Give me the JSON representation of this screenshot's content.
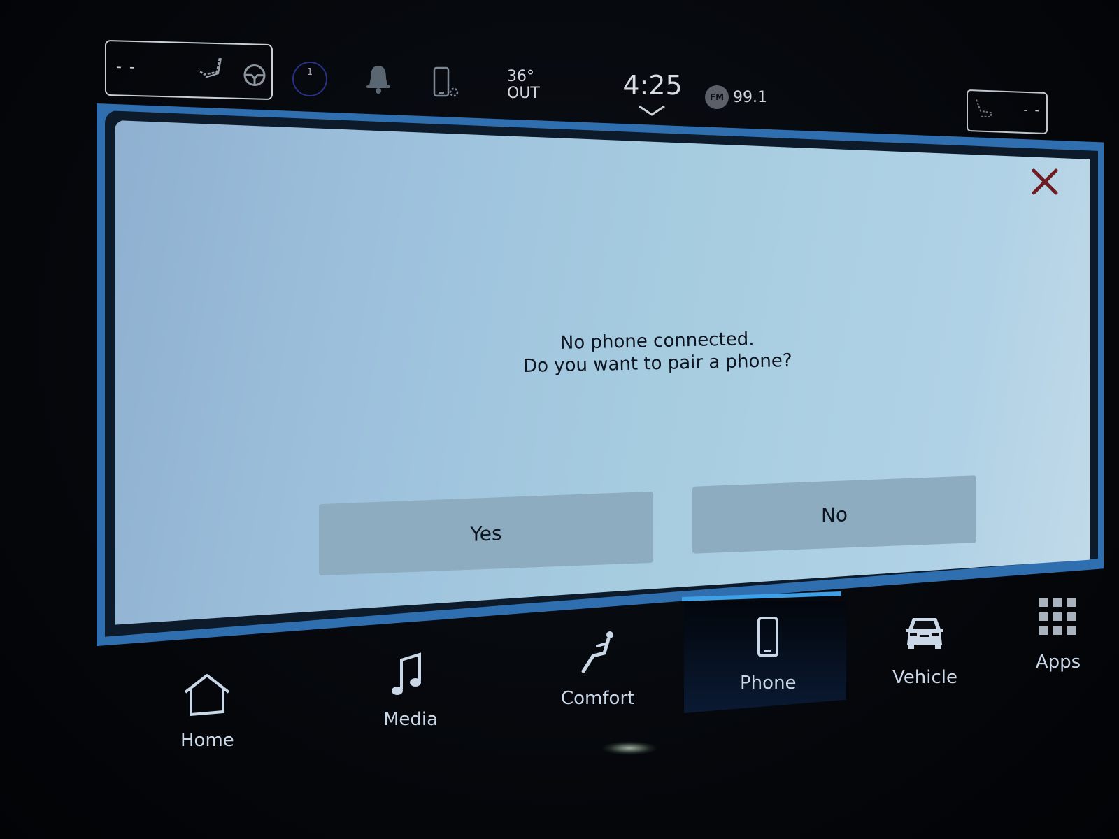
{
  "status_bar": {
    "driver_seat": {
      "value": "- -",
      "seat_icon": "heated-seat-icon",
      "wheel_icon": "heated-steering-wheel-icon"
    },
    "profile": {
      "badge": "1",
      "icon": "driver-profile-icon"
    },
    "notifications_icon": "bell-icon",
    "phone_settings_icon": "phone-settings-icon",
    "temperature": {
      "value": "36°",
      "label": "OUT"
    },
    "clock": {
      "time": "4:25",
      "chevron_icon": "chevron-down-icon"
    },
    "radio": {
      "band": "FM",
      "frequency": "99.1"
    },
    "passenger_seat": {
      "value": "- -",
      "seat_icon": "heated-seat-icon"
    }
  },
  "dialog": {
    "message_line1": "No phone connected.",
    "message_line2": "Do you want to pair a phone?",
    "yes_label": "Yes",
    "no_label": "No",
    "close_icon": "close-icon",
    "colors": {
      "frame": "#2f6fb0",
      "border": "#0c1a2a",
      "background": "#a6cce0",
      "button": "#8eacc0",
      "close": "#7a1e22"
    }
  },
  "nav": {
    "active": "Phone",
    "accent_color": "#3ea0e6",
    "items": [
      {
        "label": "Home",
        "icon": "home-icon"
      },
      {
        "label": "Media",
        "icon": "music-note-icon"
      },
      {
        "label": "Comfort",
        "icon": "seated-person-icon"
      },
      {
        "label": "Phone",
        "icon": "phone-icon"
      },
      {
        "label": "Vehicle",
        "icon": "car-icon"
      },
      {
        "label": "Apps",
        "icon": "apps-grid-icon"
      }
    ]
  }
}
